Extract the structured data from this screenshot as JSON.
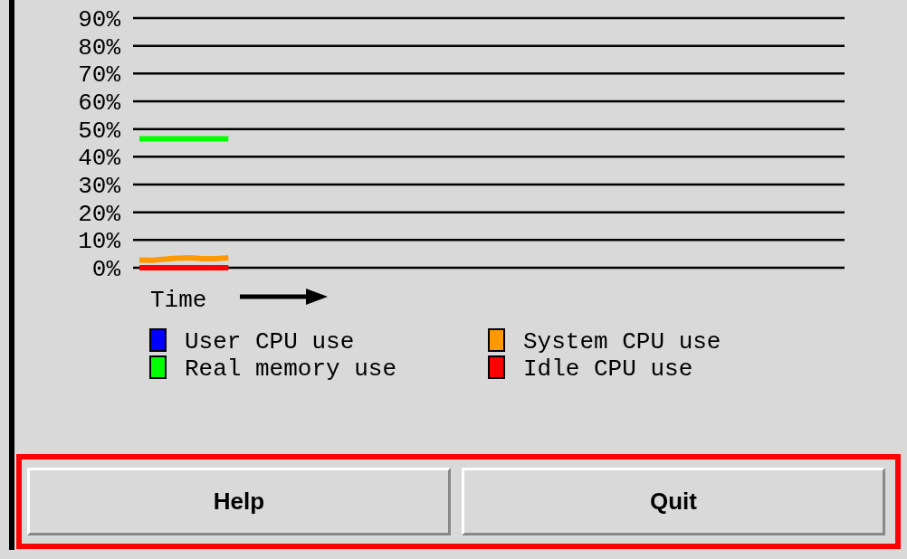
{
  "chart_data": {
    "type": "line",
    "xlabel": "Time",
    "ylim": [
      0,
      90
    ],
    "grid": true,
    "legend": true,
    "yticks": [
      {
        "value": 0,
        "label": "0%"
      },
      {
        "value": 10,
        "label": "10%"
      },
      {
        "value": 20,
        "label": "20%"
      },
      {
        "value": 30,
        "label": "30%"
      },
      {
        "value": 40,
        "label": "40%"
      },
      {
        "value": 50,
        "label": "50%"
      },
      {
        "value": 60,
        "label": "60%"
      },
      {
        "value": 70,
        "label": "70%"
      },
      {
        "value": 80,
        "label": "80%"
      },
      {
        "value": 90,
        "label": "90%"
      }
    ],
    "categories": [
      null,
      null,
      null,
      null,
      null,
      null,
      null,
      null,
      null,
      null,
      null,
      null,
      null,
      null,
      null,
      null,
      null,
      null,
      null,
      null,
      null,
      null,
      null,
      null,
      null,
      null,
      null,
      null,
      null,
      null,
      null,
      null,
      null,
      null,
      null,
      null,
      null,
      null,
      null,
      null,
      null,
      null,
      null,
      null,
      null,
      null,
      null,
      null,
      null,
      null,
      null,
      null,
      null,
      null,
      null,
      null
    ],
    "series": [
      {
        "name": "User CPU use",
        "color": "#0000ff",
        "values": [
          null,
          null,
          null,
          null,
          null,
          null,
          null,
          null,
          null,
          null,
          null,
          null,
          null,
          null,
          null,
          null,
          null,
          null,
          null,
          null,
          null,
          null,
          null,
          null,
          null,
          null,
          null,
          null,
          null,
          null,
          null,
          null,
          null,
          null,
          null,
          null,
          null,
          null,
          null,
          null,
          null,
          null,
          null,
          null,
          null,
          null,
          null,
          null,
          null,
          null,
          null,
          null,
          null,
          null,
          null,
          null
        ]
      },
      {
        "name": "System CPU use",
        "color": "#ff9900",
        "values": [
          2.8,
          2.7,
          3.1,
          3.4,
          3.6,
          3.3,
          3.3,
          3.6,
          null,
          null,
          null,
          null,
          null,
          null,
          null,
          null,
          null,
          null,
          null,
          null,
          null,
          null,
          null,
          null,
          null,
          null,
          null,
          null,
          null,
          null,
          null,
          null,
          null,
          null,
          null,
          null,
          null,
          null,
          null,
          null,
          null,
          null,
          null,
          null,
          null,
          null,
          null,
          null,
          null,
          null,
          null,
          null,
          null,
          null,
          null,
          null
        ]
      },
      {
        "name": "Real memory use",
        "color": "#00ff00",
        "values": [
          46.5,
          46.5,
          46.5,
          46.5,
          46.5,
          46.5,
          46.5,
          46.5,
          null,
          null,
          null,
          null,
          null,
          null,
          null,
          null,
          null,
          null,
          null,
          null,
          null,
          null,
          null,
          null,
          null,
          null,
          null,
          null,
          null,
          null,
          null,
          null,
          null,
          null,
          null,
          null,
          null,
          null,
          null,
          null,
          null,
          null,
          null,
          null,
          null,
          null,
          null,
          null,
          null,
          null,
          null,
          null,
          null,
          null,
          null,
          null
        ]
      },
      {
        "name": "Idle CPU use",
        "color": "#ff0000",
        "values": [
          0,
          0,
          0,
          0,
          0,
          0,
          0,
          0,
          null,
          null,
          null,
          null,
          null,
          null,
          null,
          null,
          null,
          null,
          null,
          null,
          null,
          null,
          null,
          null,
          null,
          null,
          null,
          null,
          null,
          null,
          null,
          null,
          null,
          null,
          null,
          null,
          null,
          null,
          null,
          null,
          null,
          null,
          null,
          null,
          null,
          null,
          null,
          null,
          null,
          null,
          null,
          null,
          null,
          null,
          null,
          null
        ]
      }
    ]
  },
  "buttons": [
    {
      "label": "Help"
    },
    {
      "label": "Quit"
    }
  ]
}
